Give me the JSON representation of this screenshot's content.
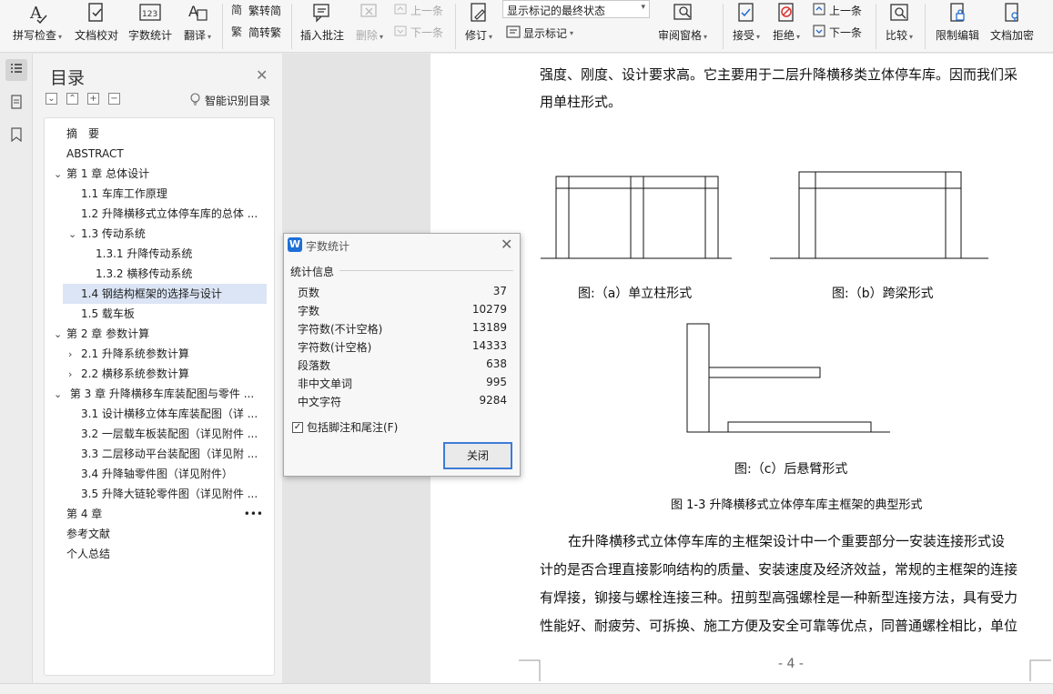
{
  "ribbon": {
    "spell_check": "拼写检查",
    "doc_proof": "文档校对",
    "word_count": "字数统计",
    "translate": "翻译",
    "trad_to_simp": "繁转简",
    "simp_to_trad": "简转繁",
    "insert_comment": "插入批注",
    "delete": "删除",
    "prev": "上一条",
    "next": "下一条",
    "track_changes": "修订",
    "display_mode": "显示标记的最终状态",
    "show_markup": "显示标记",
    "review_pane": "审阅窗格",
    "accept": "接受",
    "reject": "拒绝",
    "prev2": "上一条",
    "next2": "下一条",
    "compare": "比较",
    "restrict_edit": "限制编辑",
    "encrypt": "文档加密"
  },
  "toc": {
    "title": "目录",
    "smart_toc": "智能识别目录",
    "items": [
      {
        "label": "摘　要"
      },
      {
        "label": "ABSTRACT"
      },
      {
        "label": "第 1 章  总体设计"
      },
      {
        "label": "1.1 车库工作原理"
      },
      {
        "label": "1.2 升降横移式立体停车库的总体 ..."
      },
      {
        "label": "1.3 传动系统"
      },
      {
        "label": "1.3.1 升降传动系统"
      },
      {
        "label": "1.3.2 横移传动系统"
      },
      {
        "label": "1.4 钢结构框架的选择与设计"
      },
      {
        "label": "1.5 载车板"
      },
      {
        "label": "第 2 章  参数计算"
      },
      {
        "label": "2.1 升降系统参数计算"
      },
      {
        "label": "2.2 横移系统参数计算"
      },
      {
        "label": " 第 3 章  升降横移车库装配图与零件 ..."
      },
      {
        "label": "3.1 设计横移立体车库装配图（详 ..."
      },
      {
        "label": "3.2 一层载车板装配图（详见附件 ..."
      },
      {
        "label": "3.3 二层移动平台装配图（详见附 ..."
      },
      {
        "label": "3.4 升降轴零件图（详见附件）"
      },
      {
        "label": "3.5 升降大链轮零件图（详见附件 ..."
      },
      {
        "label": "第 4 章"
      },
      {
        "label": "参考文献"
      },
      {
        "label": "个人总结"
      }
    ]
  },
  "doc": {
    "line1": "强度、刚度、设计要求高。它主要用于二层升降横移类立体停车库。因而我们采",
    "line2": "用单柱形式。",
    "cap_a": "图:（a）单立柱形式",
    "cap_b": "图:（b）跨梁形式",
    "cap_c": "图:（c）后悬臂形式",
    "fig_title": "图 1-3    升降横移式立体停车库主框架的典型形式",
    "p1": "在升降横移式立体停车库的主框架设计中一个重要部分一安装连接形式设",
    "p2": "计的是否合理直接影响结构的质量、安装速度及经济效益，常规的主框架的连接",
    "p3": "有焊接，铆接与螺栓连接三种。扭剪型高强螺栓是一种新型连接方法，具有受力",
    "p4": "性能好、耐疲劳、可拆换、施工方便及安全可靠等优点，同普通螺栓相比，单位",
    "page_num": "- 4 -"
  },
  "dialog": {
    "title": "字数统计",
    "group": "统计信息",
    "stats": [
      {
        "k": "页数",
        "v": "37"
      },
      {
        "k": "字数",
        "v": "10279"
      },
      {
        "k": "字符数(不计空格)",
        "v": "13189"
      },
      {
        "k": "字符数(计空格)",
        "v": "14333"
      },
      {
        "k": "段落数",
        "v": "638"
      },
      {
        "k": "非中文单词",
        "v": "995"
      },
      {
        "k": "中文字符",
        "v": "9284"
      }
    ],
    "include_notes": "包括脚注和尾注(F)",
    "close": "关闭"
  }
}
